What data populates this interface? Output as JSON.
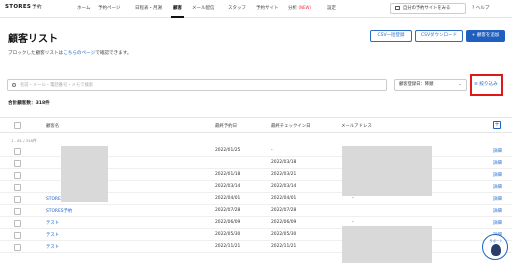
{
  "nav": {
    "brand": "STORES",
    "brand_sub": "予約",
    "items": [
      {
        "label": "ホーム",
        "new": ""
      },
      {
        "label": "予約ページ",
        "new": ""
      },
      {
        "label": "日程表・月謝",
        "new": ""
      },
      {
        "label": "顧客",
        "new": ""
      },
      {
        "label": "メール配信",
        "new": ""
      },
      {
        "label": "スタッフ",
        "new": ""
      },
      {
        "label": "予約サイト",
        "new": ""
      },
      {
        "label": "分析",
        "new": "(NEW)"
      },
      {
        "label": "設定",
        "new": ""
      }
    ],
    "active": "顧客",
    "my_site": "自分の予約サイトをみる",
    "help": "ヘルプ"
  },
  "page": {
    "title": "顧客リスト",
    "csv_import": "CSV一括登録",
    "csv_download": "CSVダウンロード",
    "add_customer": "+ 顧客を追加",
    "notice_prefix": "ブロックした顧客リストは",
    "notice_link": "こちらのページ",
    "notice_suffix": "で確認できます。"
  },
  "search": {
    "placeholder": "名前・メール・電話番号・メモで検索",
    "sort_label": "顧客登録日：降順",
    "filter_label": "絞り込み"
  },
  "total": "合計顧客数：318件",
  "table": {
    "headers": {
      "name": "顧客名",
      "last_reservation": "最終予約日",
      "last_checkin": "最終チェックイン日",
      "email": "メールアドレス"
    },
    "range": "1 - 61 / 318件",
    "rows": [
      {
        "name": "",
        "last_reservation": "2022/01/25",
        "last_checkin": "-",
        "email": "",
        "detail": "詳細"
      },
      {
        "name": "",
        "last_reservation": "",
        "last_checkin": "2022/03/18",
        "email": "",
        "detail": "詳細"
      },
      {
        "name": "",
        "last_reservation": "2022/01/18",
        "last_checkin": "2022/03/21",
        "email": "",
        "detail": "詳細"
      },
      {
        "name": "",
        "last_reservation": "2022/03/14",
        "last_checkin": "2022/03/14",
        "email": "",
        "detail": "詳細"
      },
      {
        "name": "STORES予約テスト1",
        "last_reservation": "2022/04/01",
        "last_checkin": "2022/04/01",
        "email": "-",
        "detail": "詳細"
      },
      {
        "name": "STORES予約",
        "last_reservation": "2022/07/28",
        "last_checkin": "2022/07/28",
        "email": "",
        "detail": "詳細"
      },
      {
        "name": "テスト",
        "last_reservation": "2022/06/09",
        "last_checkin": "2022/06/09",
        "email": "-",
        "detail": "詳細"
      },
      {
        "name": "テスト",
        "last_reservation": "2022/05/30",
        "last_checkin": "2022/05/30",
        "email": "",
        "detail": "詳細"
      },
      {
        "name": "テスト",
        "last_reservation": "2022/11/21",
        "last_checkin": "2022/11/21",
        "email": "",
        "detail": "詳細"
      }
    ]
  },
  "chat": {
    "label": "サポート"
  }
}
